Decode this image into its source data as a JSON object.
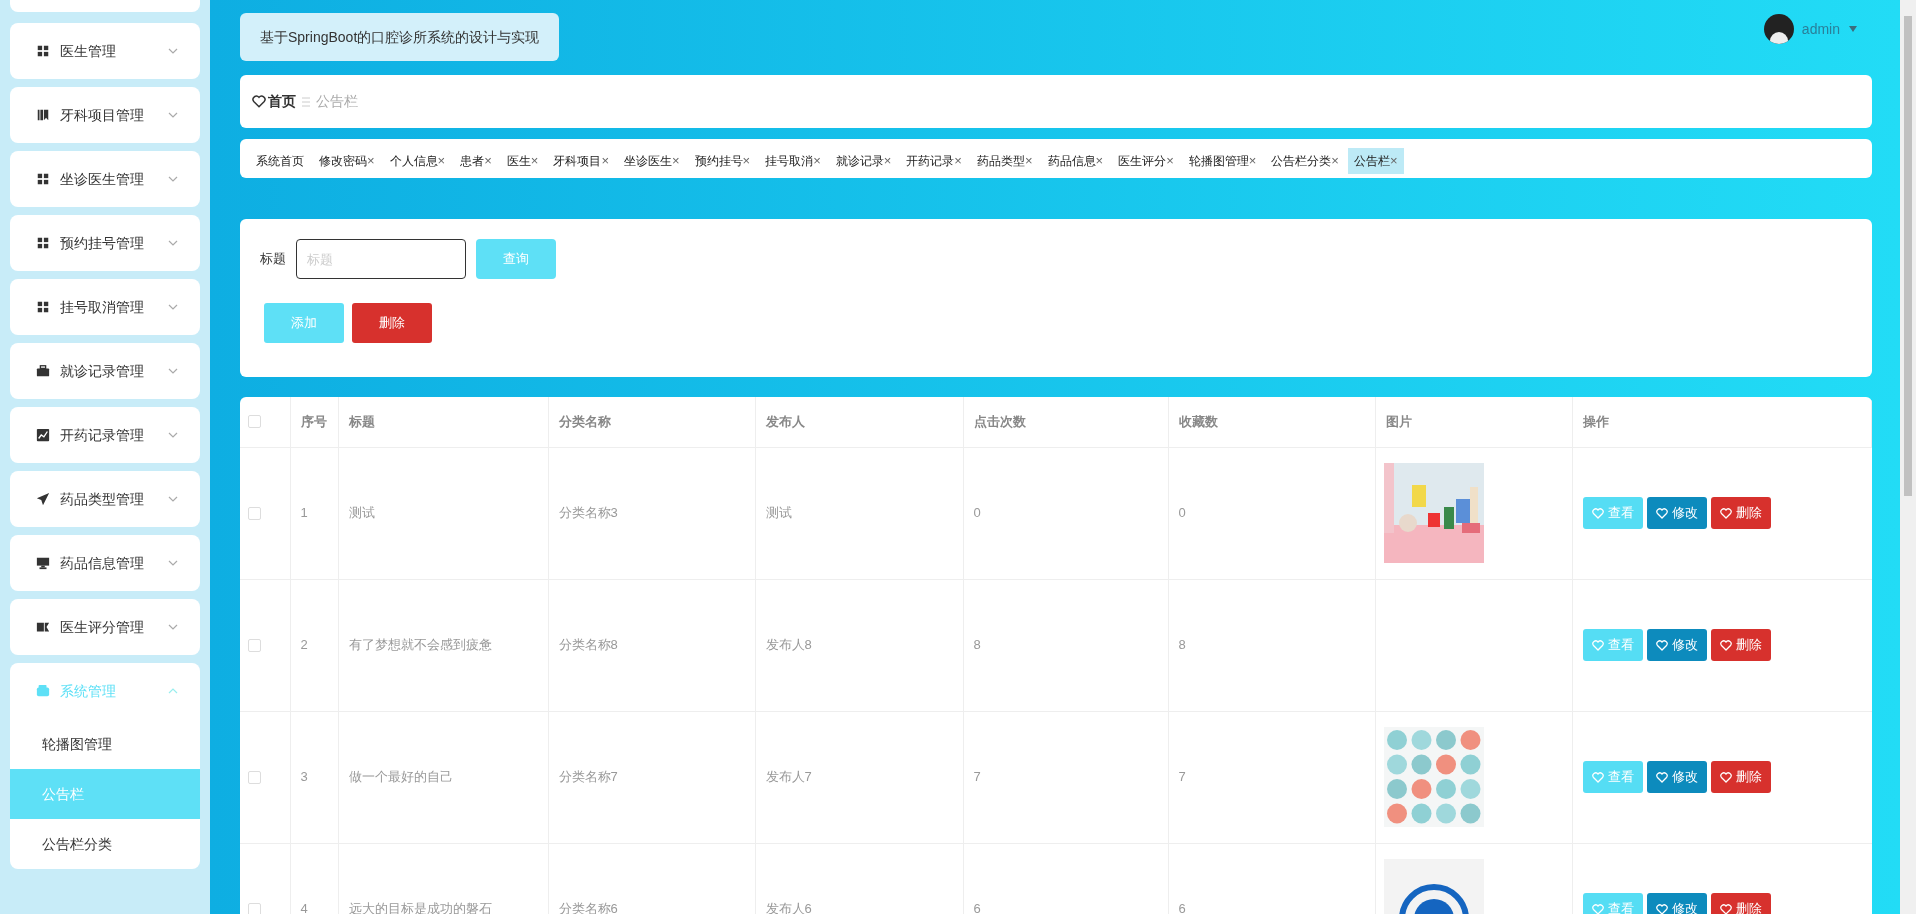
{
  "sidebar": {
    "items": [
      {
        "label": "医生管理",
        "expanded": false
      },
      {
        "label": "牙科项目管理",
        "expanded": false
      },
      {
        "label": "坐诊医生管理",
        "expanded": false
      },
      {
        "label": "预约挂号管理",
        "expanded": false
      },
      {
        "label": "挂号取消管理",
        "expanded": false
      },
      {
        "label": "就诊记录管理",
        "expanded": false
      },
      {
        "label": "开药记录管理",
        "expanded": false
      },
      {
        "label": "药品类型管理",
        "expanded": false
      },
      {
        "label": "药品信息管理",
        "expanded": false
      },
      {
        "label": "医生评分管理",
        "expanded": false
      },
      {
        "label": "系统管理",
        "expanded": true,
        "children": [
          {
            "label": "轮播图管理",
            "selected": false
          },
          {
            "label": "公告栏",
            "selected": true
          },
          {
            "label": "公告栏分类",
            "selected": false
          }
        ]
      }
    ]
  },
  "header": {
    "title": "基于SpringBoot的口腔诊所系统的设计与实现",
    "user": "admin"
  },
  "breadcrumb": [
    "首页",
    "公告栏"
  ],
  "tabs": [
    {
      "label": "系统首页",
      "closable": false,
      "selected": false
    },
    {
      "label": "修改密码",
      "closable": true,
      "selected": false
    },
    {
      "label": "个人信息",
      "closable": true,
      "selected": false
    },
    {
      "label": "患者",
      "closable": true,
      "selected": false
    },
    {
      "label": "医生",
      "closable": true,
      "selected": false
    },
    {
      "label": "牙科项目",
      "closable": true,
      "selected": false
    },
    {
      "label": "坐诊医生",
      "closable": true,
      "selected": false
    },
    {
      "label": "预约挂号",
      "closable": true,
      "selected": false
    },
    {
      "label": "挂号取消",
      "closable": true,
      "selected": false
    },
    {
      "label": "就诊记录",
      "closable": true,
      "selected": false
    },
    {
      "label": "开药记录",
      "closable": true,
      "selected": false
    },
    {
      "label": "药品类型",
      "closable": true,
      "selected": false
    },
    {
      "label": "药品信息",
      "closable": true,
      "selected": false
    },
    {
      "label": "医生评分",
      "closable": true,
      "selected": false
    },
    {
      "label": "轮播图管理",
      "closable": true,
      "selected": false
    },
    {
      "label": "公告栏分类",
      "closable": true,
      "selected": false
    },
    {
      "label": "公告栏",
      "closable": true,
      "selected": true
    }
  ],
  "tab_close": "×",
  "search": {
    "label": "标题",
    "placeholder": "标题",
    "button": "查询",
    "add_button": "添加",
    "delete_button": "删除"
  },
  "table": {
    "columns": [
      "序号",
      "标题",
      "分类名称",
      "发布人",
      "点击次数",
      "收藏数",
      "图片",
      "操作"
    ],
    "all_checked": false,
    "rows": [
      {
        "cells": [
          "1",
          "测试",
          "分类名称3",
          "测试",
          "0",
          "0"
        ],
        "checked": false,
        "picture": {
          "kind": "picture"
        },
        "actions": [
          "查看",
          "修改",
          "删除"
        ]
      },
      {
        "cells": [
          "2",
          "有了梦想就不会感到疲惫",
          "分类名称8",
          "发布人8",
          "8",
          "8"
        ],
        "checked": false,
        "actions": [
          "查看",
          "修改",
          "删除"
        ]
      },
      {
        "cells": [
          "3",
          "做一个最好的自己",
          "分类名称7",
          "发布人7",
          "7",
          "7"
        ],
        "checked": false,
        "picture": {
          "kind": "picture"
        },
        "actions": [
          "查看",
          "修改",
          "删除"
        ]
      },
      {
        "cells": [
          "4",
          "远大的目标是成功的磐石",
          "分类名称6",
          "发布人6",
          "6",
          "6"
        ],
        "checked": false,
        "picture": {
          "kind": "picture"
        },
        "actions": [
          "查看",
          "修改",
          "删除"
        ]
      }
    ]
  }
}
